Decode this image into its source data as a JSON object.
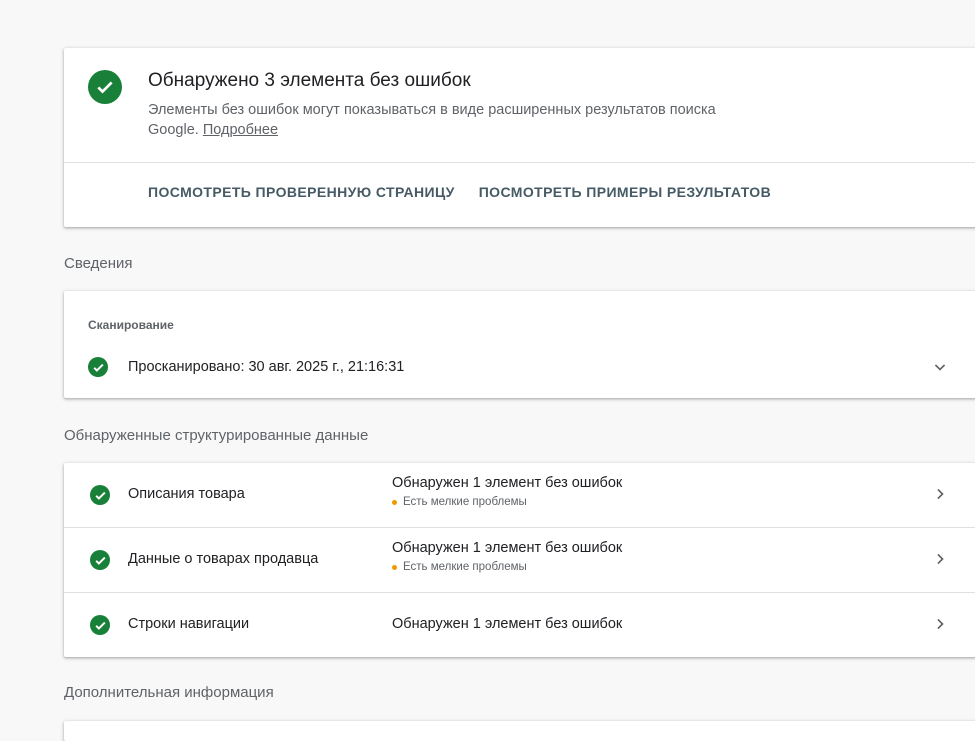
{
  "summary": {
    "title": "Обнаружено 3 элемента без ошибок",
    "description": "Элементы без ошибок могут показываться в виде расширенных результатов поиска Google.",
    "more_link": "Подробнее",
    "actions": [
      "ПОСМОТРЕТЬ ПРОВЕРЕННУЮ СТРАНИЦУ",
      "ПОСМОТРЕТЬ ПРИМЕРЫ РЕЗУЛЬТАТОВ"
    ]
  },
  "details": {
    "section_title": "Сведения",
    "crawl_heading": "Сканирование",
    "crawl_status": "Просканировано: 30 авг. 2025 г., 21:16:31"
  },
  "structured_data": {
    "section_title": "Обнаруженные структурированные данные",
    "items": [
      {
        "name": "Описания товара",
        "status": "Обнаружен 1 элемент без ошибок",
        "issue": "Есть мелкие проблемы"
      },
      {
        "name": "Данные о товарах продавца",
        "status": "Обнаружен 1 элемент без ошибок",
        "issue": "Есть мелкие проблемы"
      },
      {
        "name": "Строки навигации",
        "status": "Обнаружен 1 элемент без ошибок",
        "issue": ""
      }
    ]
  },
  "additional": {
    "section_title": "Дополнительная информация"
  },
  "colors": {
    "success": "#188038",
    "warning": "#f29900",
    "secondary_text": "#5f6368"
  },
  "icons": [
    "check-circle-icon",
    "chevron-down-icon",
    "chevron-right-icon",
    "warning-dot-icon"
  ]
}
